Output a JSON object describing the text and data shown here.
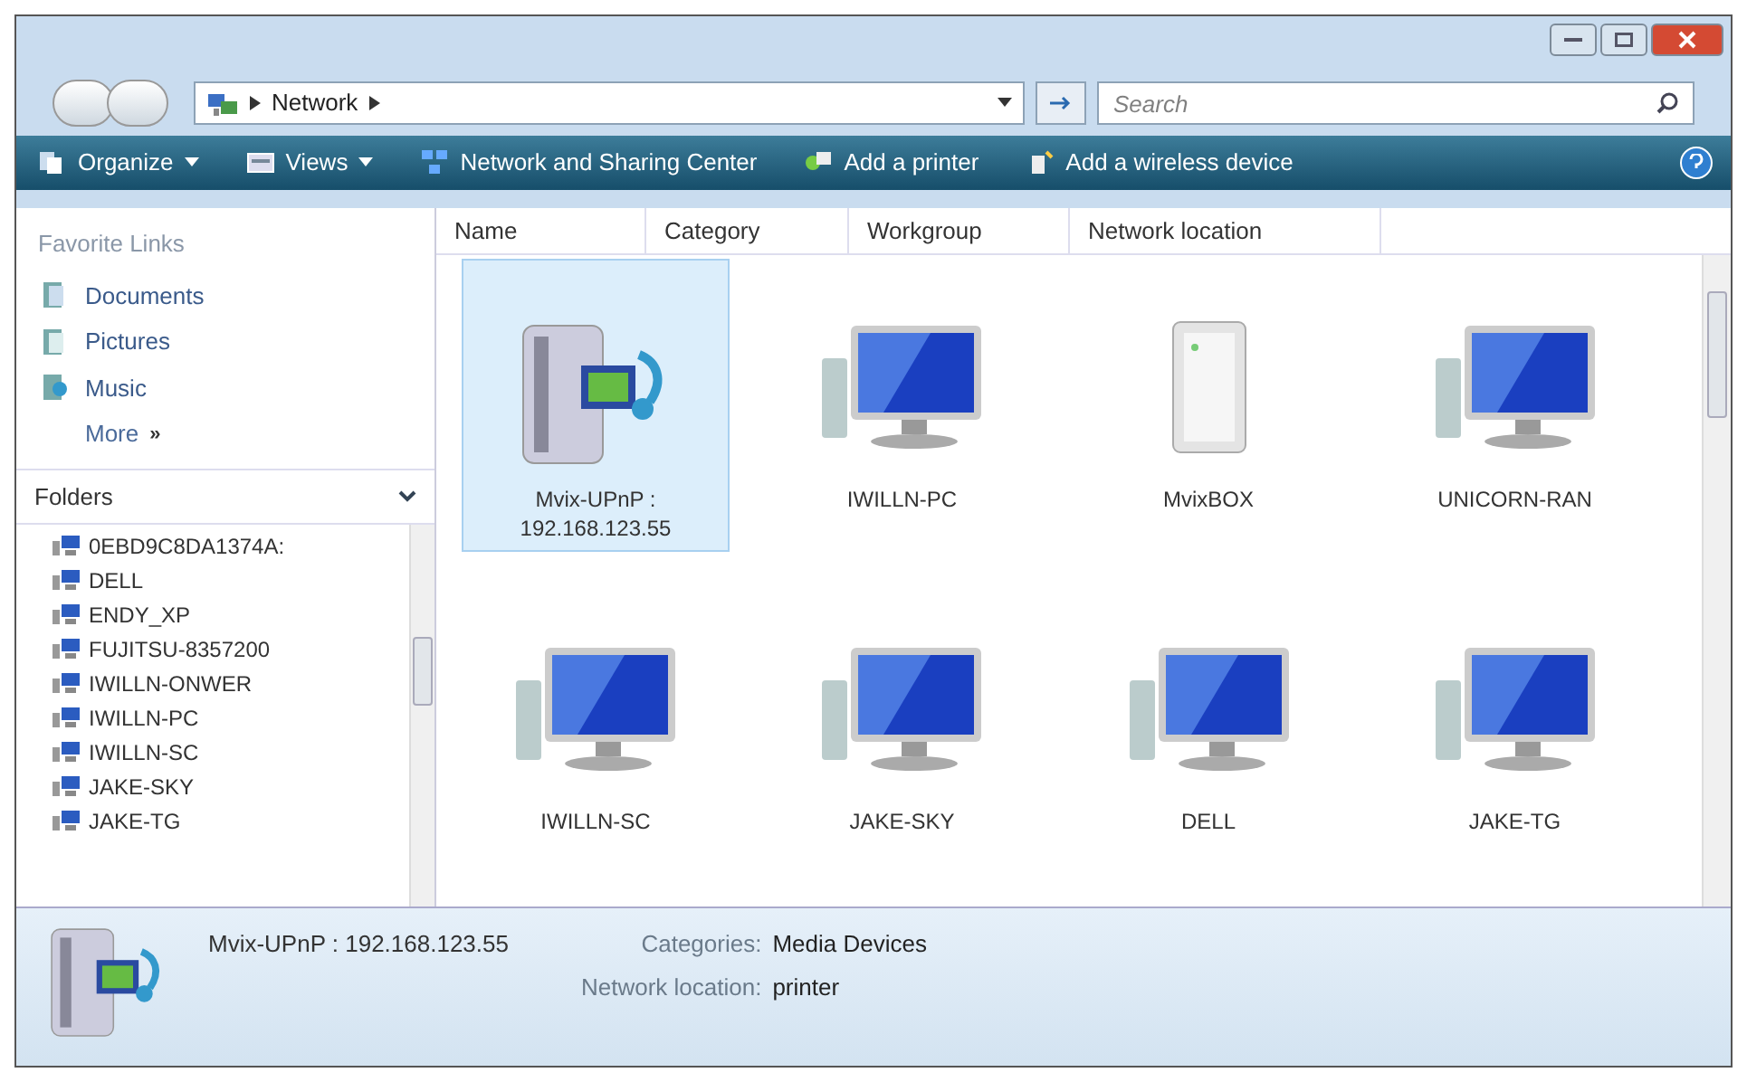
{
  "address_bar": {
    "crumbs": [
      "Network"
    ],
    "search": {
      "placeholder": "Search"
    }
  },
  "toolbar": [
    {
      "label": "Organize",
      "kind": "dropdown"
    },
    {
      "label": "Views",
      "kind": "dropdown"
    },
    {
      "label": "Network and Sharing Center",
      "kind": "button"
    },
    {
      "label": "Add a printer",
      "kind": "button"
    },
    {
      "label": "Add a wireless device",
      "kind": "button"
    }
  ],
  "sidebar": {
    "favorites_title": "Favorite Links",
    "favorites": [
      {
        "label": "Documents",
        "kind": "documents"
      },
      {
        "label": "Pictures",
        "kind": "pictures"
      },
      {
        "label": "Music",
        "kind": "music"
      }
    ],
    "more": "More",
    "more_glyph": "»",
    "folders_title": "Folders",
    "folders": [
      "0EBD9C8DA1374A:",
      "DELL",
      "ENDY_XP",
      "FUJITSU-8357200",
      "IWILLN-ONWER",
      "IWILLN-PC",
      "IWILLN-SC",
      "JAKE-SKY",
      "JAKE-TG"
    ]
  },
  "columns": [
    "Name",
    "Category",
    "Workgroup",
    "Network location"
  ],
  "items": [
    {
      "label": "Mvix-UPnP : 192.168.123.55",
      "kind": "media",
      "selected": true
    },
    {
      "label": "IWILLN-PC",
      "kind": "computer",
      "selected": false
    },
    {
      "label": "MvixBOX",
      "kind": "server",
      "selected": false
    },
    {
      "label": "UNICORN-RAN",
      "kind": "computer",
      "selected": false
    },
    {
      "label": "IWILLN-SC",
      "kind": "computer",
      "selected": false
    },
    {
      "label": "JAKE-SKY",
      "kind": "computer",
      "selected": false
    },
    {
      "label": "DELL",
      "kind": "computer",
      "selected": false
    },
    {
      "label": "JAKE-TG",
      "kind": "computer",
      "selected": false
    }
  ],
  "details": {
    "name": "Mvix-UPnP : 192.168.123.55",
    "fields": [
      {
        "label": "Categories:",
        "value": "Media Devices"
      },
      {
        "label": "Network location:",
        "value": "printer"
      }
    ]
  }
}
